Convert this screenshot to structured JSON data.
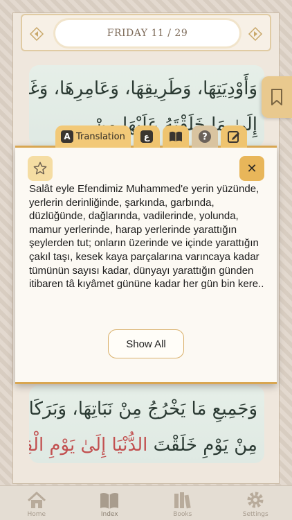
{
  "header": {
    "date_label": "FRIDAY 11 / 29"
  },
  "arabic": {
    "top_line_1": "وَأَوْدِيَتِهَا، وَطَرِيقِهَا، وَعَامِرِهَا، وَغَامِرِهَا",
    "top_line_2": "إِلَىٰ مَا خَلَقْتَهُ عَلَيْهَا مِنْ",
    "bottom_line_1": "وَجَمِيعِ مَا يَخْرُجُ مِنْ نَبَاتِهَا، وَبَرَكَاتِهَا",
    "bottom_line_2_pre": "مِنْ يَوْمِ خَلَقْتَ",
    "bottom_line_2_post": " الدُّنْيَا إِلَىٰ يَوْمِ الْقِيَامَةِ"
  },
  "tabs": {
    "translation_label": "Translation",
    "translation_icon_letter": "A",
    "arabic_icon_letter": "ع"
  },
  "popup": {
    "text": "Salât eyle Efendimiz Muhammed'e yerin yüzünde, yerlerin derinliğinde, şarkında, garbında, düzlüğünde, dağlarında, vadilerinde, yolunda, mamur yerlerinde, harap yerlerinde yarattığın şeylerden tut; onların üzerinde ve içinde yarattığın çakıl taşı, kesek kaya parçalarına varıncaya kadar tümünün sayısı kadar, dünyayı yarattığın günden itibaren tâ kıyâmet gününe kadar her gün bin kere..",
    "show_all_label": "Show All",
    "close_symbol": "✕"
  },
  "bottom_nav": [
    {
      "label": "Home",
      "icon": "home-icon"
    },
    {
      "label": "Index",
      "icon": "book-icon",
      "active": true
    },
    {
      "label": "Books",
      "icon": "books-icon"
    },
    {
      "label": "Settings",
      "icon": "gear-icon"
    }
  ],
  "colors": {
    "accent": "#f0c97a",
    "panel": "#e6efe8",
    "highlight": "#c25050"
  }
}
